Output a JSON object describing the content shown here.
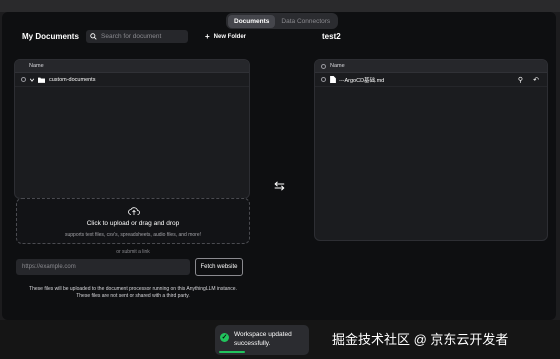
{
  "tabs": [
    "Documents",
    "Data Connectors"
  ],
  "left": {
    "title": "My Documents",
    "search_placeholder": "Search for document",
    "new_folder": "New Folder",
    "column_name": "Name",
    "rows": [
      {
        "name": "custom-documents"
      }
    ]
  },
  "right": {
    "title": "test2",
    "column_name": "Name",
    "rows": [
      {
        "name": "---ArgoCD基础.md"
      }
    ]
  },
  "upload": {
    "title": "Click to upload or drag and drop",
    "subtitle": "supports text files, csv's, spreadsheets, audio files, and more!",
    "or_link": "or submit a link",
    "url_placeholder": "https://example.com",
    "fetch_button": "Fetch website",
    "disclaimer_1": "These files will be uploaded to the document processor running on this AnythingLLM instance.",
    "disclaimer_2": "These files are not sent or shared with a third party."
  },
  "toast": {
    "line1": "Workspace updated",
    "line2": "successfully."
  },
  "watermark": "掘金技术社区 @ 京东云开发者",
  "colors": {
    "success": "#21c45d",
    "background": "#0e0f11",
    "panel": "#1b1c1f"
  }
}
